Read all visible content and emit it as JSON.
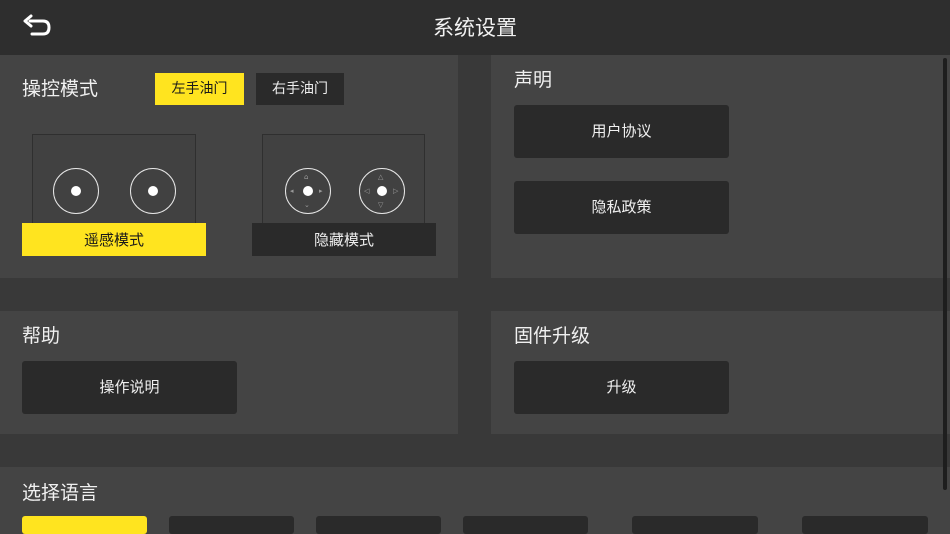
{
  "header": {
    "title": "系统设置"
  },
  "control": {
    "title": "操控模式",
    "throttle_left": "左手油门",
    "throttle_right": "右手油门",
    "mode_joystick": "遥感模式",
    "mode_hidden": "隐藏模式"
  },
  "statement": {
    "title": "声明",
    "user_agreement": "用户协议",
    "privacy_policy": "隐私政策"
  },
  "help": {
    "title": "帮助",
    "instructions": "操作说明"
  },
  "firmware": {
    "title": "固件升级",
    "upgrade": "升级"
  },
  "language": {
    "title": "选择语言",
    "selected_index": 0
  },
  "colors": {
    "accent": "#ffe41f",
    "button": "#2a2a2a",
    "panel": "#444444",
    "background": "#393939"
  }
}
